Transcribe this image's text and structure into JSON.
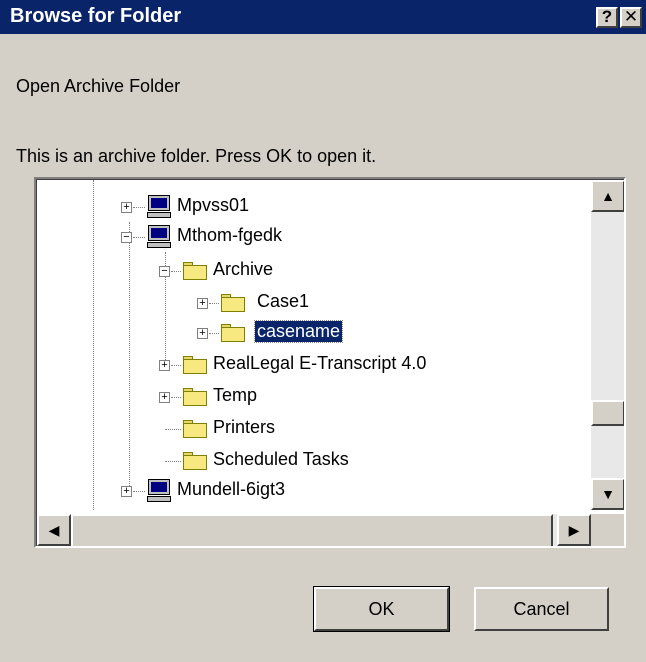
{
  "window": {
    "title": "Browse for Folder",
    "help_glyph": "?",
    "close_glyph": "✕"
  },
  "dialog": {
    "prompt": "Open Archive Folder",
    "description": "This is an archive folder. Press OK to open it."
  },
  "tree": {
    "items": [
      {
        "label": "Mpvss01",
        "icon": "computer-icon"
      },
      {
        "label": "Mthom-fgedk",
        "icon": "computer-icon"
      },
      {
        "label": "Archive",
        "icon": "folder-open-icon"
      },
      {
        "label": "Case1",
        "icon": "folder-icon"
      },
      {
        "label": "casename",
        "icon": "folder-open-icon",
        "selected": true
      },
      {
        "label": "RealLegal E-Transcript 4.0",
        "icon": "folder-icon"
      },
      {
        "label": "Temp",
        "icon": "folder-icon"
      },
      {
        "label": "Printers",
        "icon": "printers-folder-icon"
      },
      {
        "label": "Scheduled Tasks",
        "icon": "scheduled-tasks-folder-icon"
      },
      {
        "label": "Mundell-6igt3",
        "icon": "computer-icon"
      }
    ]
  },
  "buttons": {
    "ok": "OK",
    "cancel": "Cancel"
  },
  "colors": {
    "titlebar": "#0a246a",
    "face": "#d4d0c8",
    "selection": "#0a246a"
  }
}
